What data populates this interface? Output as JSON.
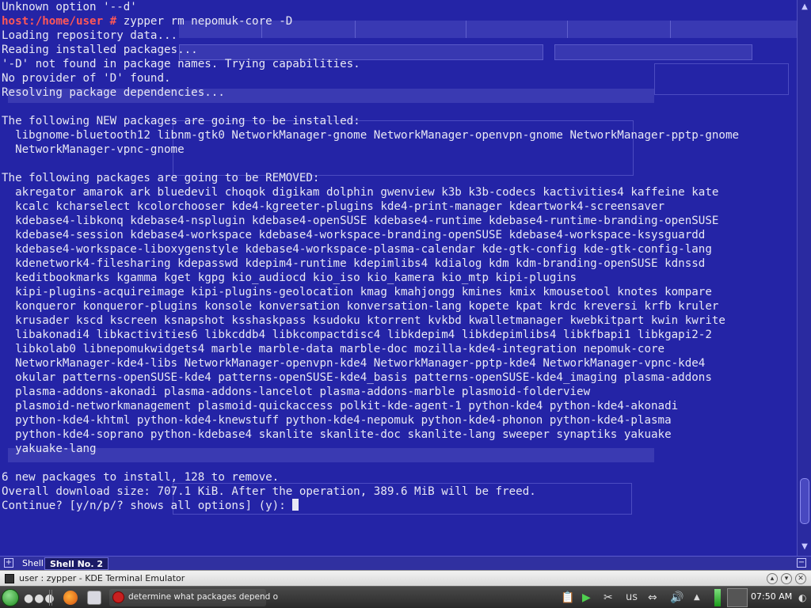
{
  "terminal": {
    "lines": [
      {
        "text": "Unknown option '--d'"
      },
      {
        "prompt": "host:/home/user #",
        "text": " zypper rm nepomuk-core -D"
      },
      {
        "text": "Loading repository data..."
      },
      {
        "text": "Reading installed packages..."
      },
      {
        "text": "'-D' not found in package names. Trying capabilities."
      },
      {
        "text": "No provider of 'D' found."
      },
      {
        "text": "Resolving package dependencies..."
      },
      {
        "text": ""
      },
      {
        "text": "The following NEW packages are going to be installed:"
      },
      {
        "text": "  libgnome-bluetooth12 libnm-gtk0 NetworkManager-gnome NetworkManager-openvpn-gnome NetworkManager-pptp-gnome"
      },
      {
        "text": "  NetworkManager-vpnc-gnome"
      },
      {
        "text": ""
      },
      {
        "text": "The following packages are going to be REMOVED:"
      },
      {
        "text": "  akregator amarok ark bluedevil choqok digikam dolphin gwenview k3b k3b-codecs kactivities4 kaffeine kate"
      },
      {
        "text": "  kcalc kcharselect kcolorchooser kde4-kgreeter-plugins kde4-print-manager kdeartwork4-screensaver"
      },
      {
        "text": "  kdebase4-libkonq kdebase4-nsplugin kdebase4-openSUSE kdebase4-runtime kdebase4-runtime-branding-openSUSE"
      },
      {
        "text": "  kdebase4-session kdebase4-workspace kdebase4-workspace-branding-openSUSE kdebase4-workspace-ksysguardd"
      },
      {
        "text": "  kdebase4-workspace-liboxygenstyle kdebase4-workspace-plasma-calendar kde-gtk-config kde-gtk-config-lang"
      },
      {
        "text": "  kdenetwork4-filesharing kdepasswd kdepim4-runtime kdepimlibs4 kdialog kdm kdm-branding-openSUSE kdnssd"
      },
      {
        "text": "  keditbookmarks kgamma kget kgpg kio_audiocd kio_iso kio_kamera kio_mtp kipi-plugins"
      },
      {
        "text": "  kipi-plugins-acquireimage kipi-plugins-geolocation kmag kmahjongg kmines kmix kmousetool knotes kompare"
      },
      {
        "text": "  konqueror konqueror-plugins konsole konversation konversation-lang kopete kpat krdc kreversi krfb kruler"
      },
      {
        "text": "  krusader kscd kscreen ksnapshot ksshaskpass ksudoku ktorrent kvkbd kwalletmanager kwebkitpart kwin kwrite"
      },
      {
        "text": "  libakonadi4 libkactivities6 libkcddb4 libkcompactdisc4 libkdepim4 libkdepimlibs4 libkfbapi1 libkgapi2-2"
      },
      {
        "text": "  libkolab0 libnepomukwidgets4 marble marble-data marble-doc mozilla-kde4-integration nepomuk-core"
      },
      {
        "text": "  NetworkManager-kde4-libs NetworkManager-openvpn-kde4 NetworkManager-pptp-kde4 NetworkManager-vpnc-kde4"
      },
      {
        "text": "  okular patterns-openSUSE-kde4 patterns-openSUSE-kde4_basis patterns-openSUSE-kde4_imaging plasma-addons"
      },
      {
        "text": "  plasma-addons-akonadi plasma-addons-lancelot plasma-addons-marble plasmoid-folderview"
      },
      {
        "text": "  plasmoid-networkmanagement plasmoid-quickaccess polkit-kde-agent-1 python-kde4 python-kde4-akonadi"
      },
      {
        "text": "  python-kde4-khtml python-kde4-knewstuff python-kde4-nepomuk python-kde4-phonon python-kde4-plasma"
      },
      {
        "text": "  python-kde4-soprano python-kdebase4 skanlite skanlite-doc skanlite-lang sweeper synaptiks yakuake"
      },
      {
        "text": "  yakuake-lang"
      },
      {
        "text": ""
      },
      {
        "text": "6 new packages to install, 128 to remove."
      },
      {
        "text": "Overall download size: 707.1 KiB. After the operation, 389.6 MiB will be freed."
      },
      {
        "text": "Continue? [y/n/p/? shows all options] (y): ",
        "cursor": true
      }
    ]
  },
  "konsole_tabs": [
    {
      "label": "Shell",
      "active": false
    },
    {
      "label": "Shell No. 2",
      "active": true
    }
  ],
  "window": {
    "title": "user : zypper - KDE Terminal Emulator"
  },
  "taskbar": {
    "task_label": "determine what packages depend o",
    "keyboard_layout": "us",
    "clock": "07:50 AM"
  },
  "colors": {
    "terminal_bg": "#2424a6",
    "prompt": "#ff5757",
    "text": "#e8e8f4"
  }
}
